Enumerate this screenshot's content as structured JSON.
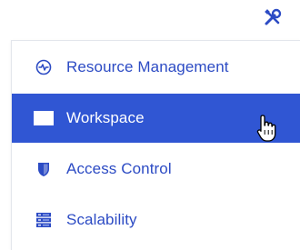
{
  "header": {
    "tools_icon": "tools-icon"
  },
  "menu": {
    "items": [
      {
        "label": "Resource Management",
        "icon": "resource-management-icon",
        "active": false
      },
      {
        "label": "Workspace",
        "icon": "workspace-icon",
        "active": true
      },
      {
        "label": "Access Control",
        "icon": "shield-icon",
        "active": false
      },
      {
        "label": "Scalability",
        "icon": "server-stack-icon",
        "active": false
      }
    ]
  },
  "colors": {
    "accent": "#3056d3",
    "link_text": "#2c4bc4",
    "icon_blue": "#2c4bc4"
  }
}
